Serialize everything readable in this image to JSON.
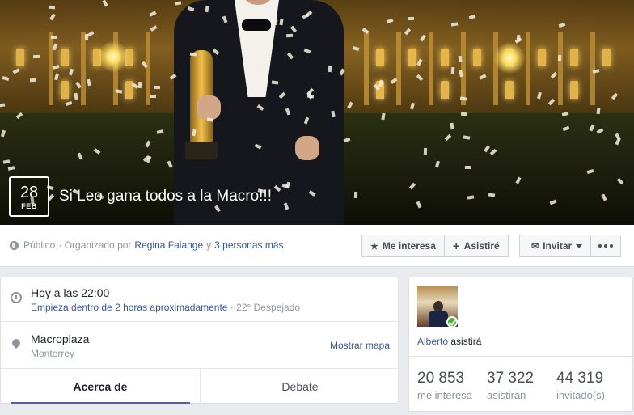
{
  "event": {
    "date_day": "28",
    "date_month": "FEB",
    "title": "Si Leo gana todos a la Macro!!!"
  },
  "meta": {
    "privacy": "Público",
    "organized_by_prefix": "· Organizado por",
    "organizer": "Regina Falange",
    "and": "y",
    "others": "3 personas más"
  },
  "actions": {
    "interested": "Me interesa",
    "going": "Asistiré",
    "invite": "Invitar",
    "interested_icon": "star-icon",
    "going_icon": "plus-icon",
    "invite_icon": "envelope-icon"
  },
  "details": {
    "time_main": "Hoy a las 22:00",
    "time_relative": "Empieza dentro de 2 horas aproximadamente",
    "time_weather": "· 22° Despejado",
    "place_name": "Macroplaza",
    "place_city": "Monterrey",
    "show_map": "Mostrar mapa"
  },
  "tabs": [
    {
      "label": "Acerca de",
      "active": true
    },
    {
      "label": "Debate",
      "active": false
    }
  ],
  "attendee": {
    "name": "Alberto",
    "status": "asistirá"
  },
  "stats": [
    {
      "number": "20 853",
      "label": "me interesa"
    },
    {
      "number": "37 322",
      "label": "asistirán"
    },
    {
      "number": "44 319",
      "label": "invitado(s)"
    }
  ],
  "colors": {
    "link": "#365899",
    "tab_active": "#4267b2",
    "check": "#42b72a"
  }
}
